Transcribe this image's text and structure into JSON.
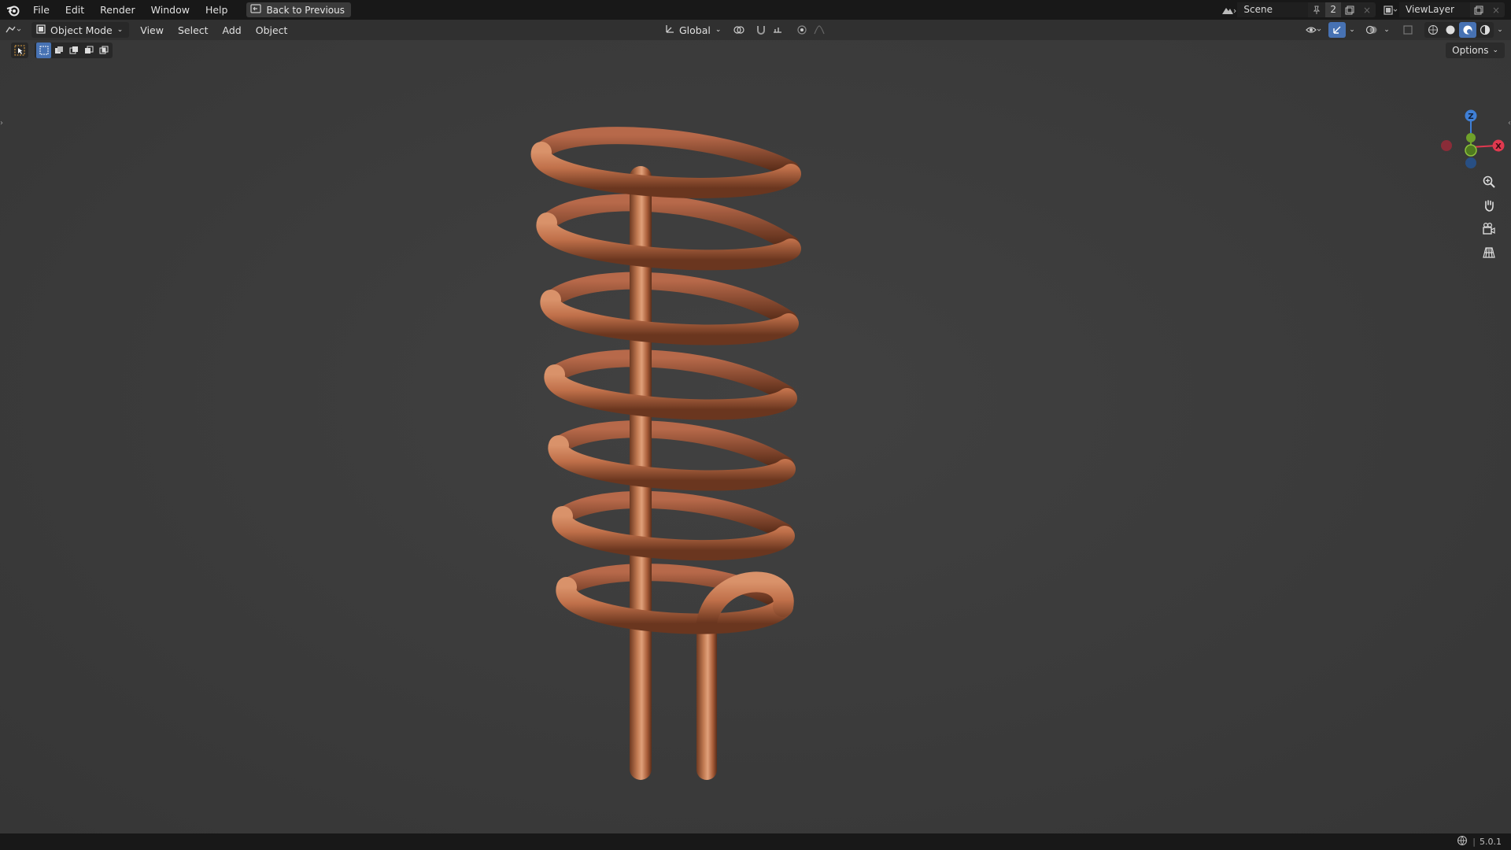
{
  "menu": {
    "items": [
      "File",
      "Edit",
      "Render",
      "Window",
      "Help"
    ],
    "back_button": "Back to Previous"
  },
  "top_right": {
    "scene_name": "Scene",
    "scene_users": "2",
    "view_layer": "ViewLayer"
  },
  "header": {
    "mode": "Object Mode",
    "menus": [
      "View",
      "Select",
      "Add",
      "Object"
    ],
    "transform_orientation": "Global"
  },
  "viewport": {
    "options_label": "Options",
    "gizmo": {
      "z": "Z",
      "x": "X",
      "y": "Y"
    },
    "object": "copper-helix-coil"
  },
  "statusbar": {
    "version": "5.0.1"
  },
  "colors": {
    "accent_blue": "#4772b3",
    "axis_x": "#e0394f",
    "axis_y": "#6fa12a",
    "axis_z": "#3f7fd6",
    "copper": "#c0704a"
  }
}
